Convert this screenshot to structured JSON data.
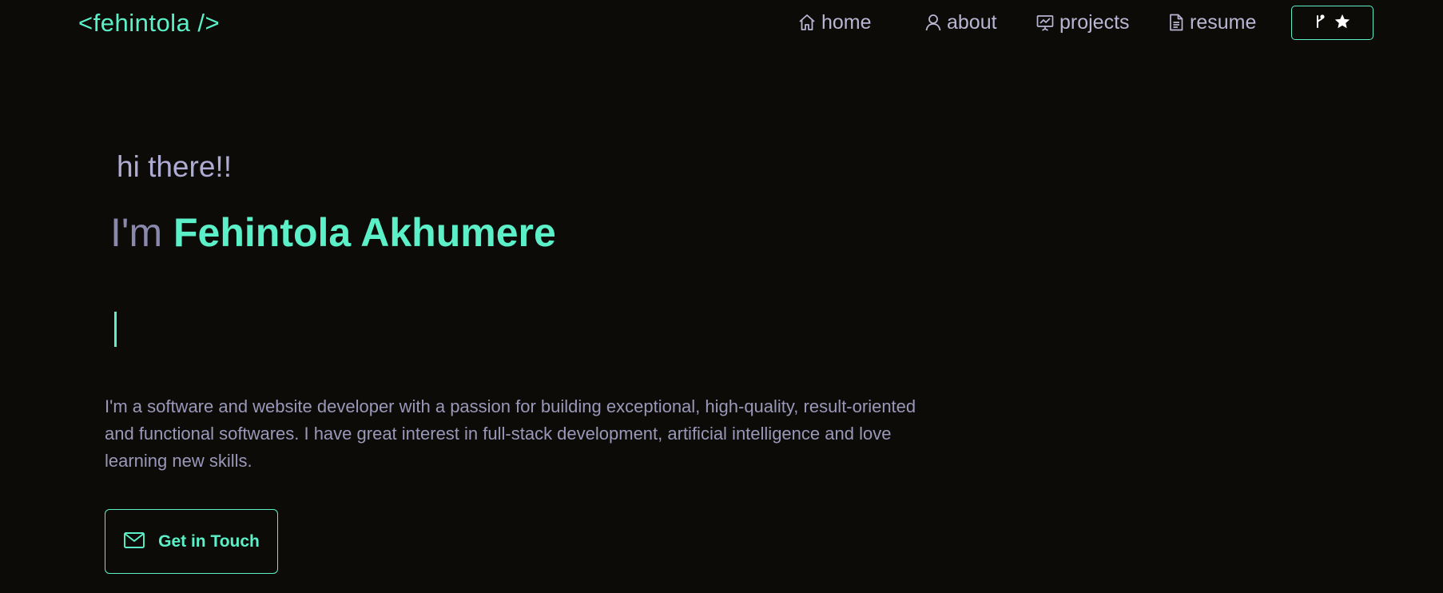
{
  "header": {
    "logo": "<fehintola />",
    "nav": [
      {
        "label": "home",
        "icon": "home-icon"
      },
      {
        "label": "about",
        "icon": "user-icon"
      },
      {
        "label": "projects",
        "icon": "presentation-icon"
      },
      {
        "label": "resume",
        "icon": "document-icon"
      }
    ],
    "github_button": {
      "icons": [
        "git-fork-icon",
        "star-icon"
      ]
    }
  },
  "hero": {
    "greeting": "hi there!!",
    "intro_prefix": "I'm",
    "name": "Fehintola Akhumere",
    "bio": "I'm a software and website developer with a passion for building exceptional, high-quality, result-oriented and functional softwares. I have great interest in full-stack development, artificial intelligence and love learning new skills.",
    "cta_label": "Get in Touch",
    "cta_icon": "mail-icon"
  },
  "colors": {
    "background": "#0d0b08",
    "accent": "#5cf0c8",
    "text_muted": "#9a98b8",
    "nav_text": "#b8b6d2"
  }
}
